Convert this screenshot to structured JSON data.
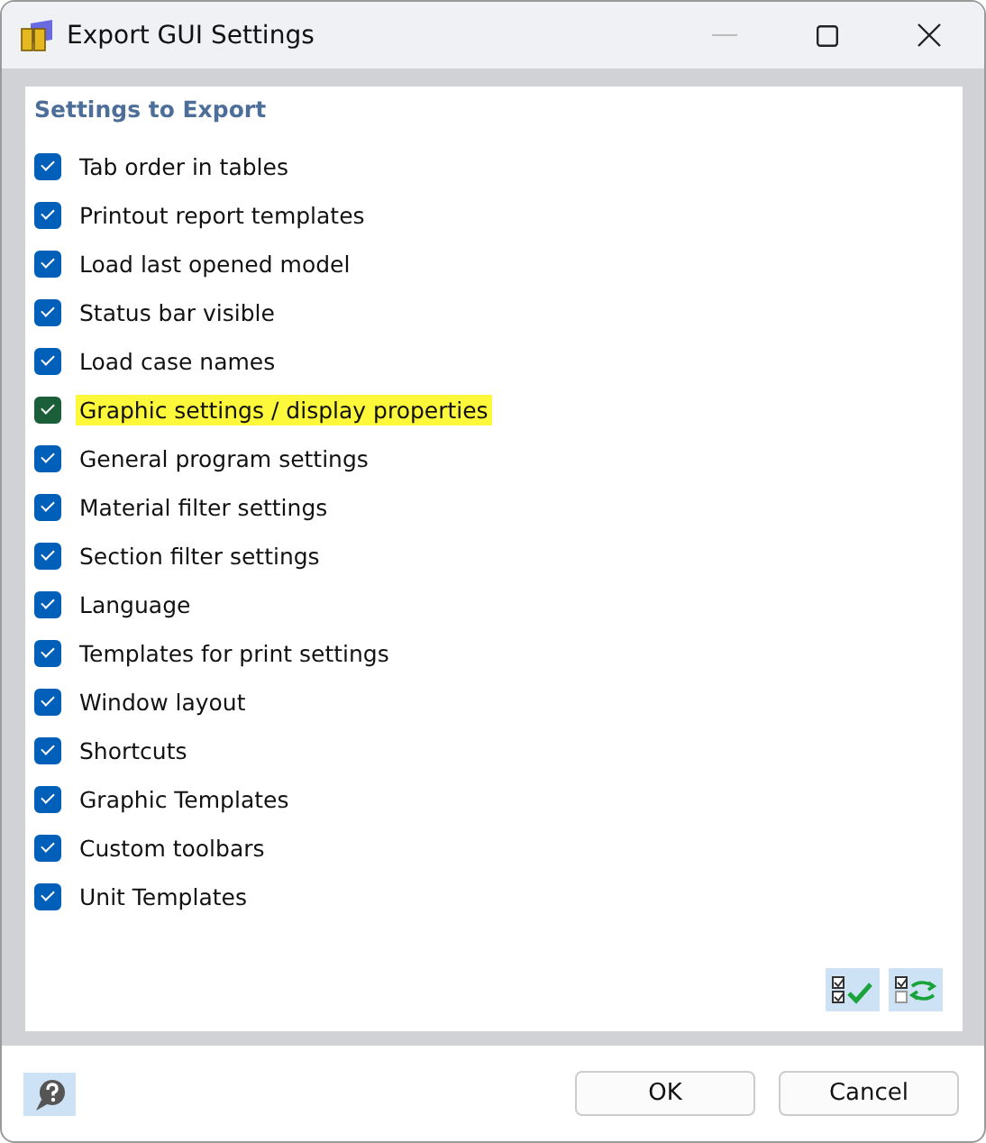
{
  "window": {
    "title": "Export GUI Settings"
  },
  "group": {
    "title": "Settings to Export"
  },
  "settings": [
    {
      "label": "Tab order in tables",
      "checked": true,
      "selected": false
    },
    {
      "label": "Printout report templates",
      "checked": true,
      "selected": false
    },
    {
      "label": "Load last opened model",
      "checked": true,
      "selected": false
    },
    {
      "label": "Status bar visible",
      "checked": true,
      "selected": false
    },
    {
      "label": "Load case names",
      "checked": true,
      "selected": false
    },
    {
      "label": "Graphic settings / display properties",
      "checked": true,
      "selected": true
    },
    {
      "label": "General program settings",
      "checked": true,
      "selected": false
    },
    {
      "label": "Material filter settings",
      "checked": true,
      "selected": false
    },
    {
      "label": "Section filter settings",
      "checked": true,
      "selected": false
    },
    {
      "label": "Language",
      "checked": true,
      "selected": false
    },
    {
      "label": "Templates for print settings",
      "checked": true,
      "selected": false
    },
    {
      "label": "Window layout",
      "checked": true,
      "selected": false
    },
    {
      "label": "Shortcuts",
      "checked": true,
      "selected": false
    },
    {
      "label": "Graphic Templates",
      "checked": true,
      "selected": false
    },
    {
      "label": "Custom toolbars",
      "checked": true,
      "selected": false
    },
    {
      "label": "Unit Templates",
      "checked": true,
      "selected": false
    }
  ],
  "buttons": [
    "OK",
    "Cancel"
  ]
}
